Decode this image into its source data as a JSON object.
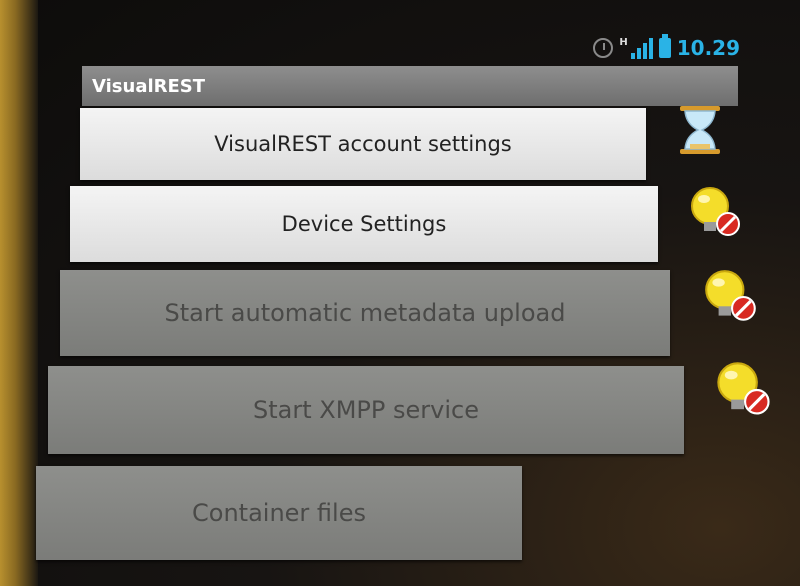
{
  "status_bar": {
    "time": "10.29",
    "network_label": "H",
    "icons": [
      "alarm-icon",
      "signal-icon",
      "battery-icon"
    ],
    "accent_color": "#2ab3e6"
  },
  "app": {
    "title": "VisualREST"
  },
  "buttons": [
    {
      "label": "VisualREST account settings",
      "enabled": true,
      "status_icon": "hourglass-icon"
    },
    {
      "label": "Device Settings",
      "enabled": true,
      "status_icon": "lightbulb-off-icon"
    },
    {
      "label": "Start automatic metadata upload",
      "enabled": false,
      "status_icon": "lightbulb-off-icon"
    },
    {
      "label": "Start XMPP service",
      "enabled": false,
      "status_icon": "lightbulb-off-icon"
    },
    {
      "label": "Container files",
      "enabled": false,
      "status_icon": null
    }
  ]
}
